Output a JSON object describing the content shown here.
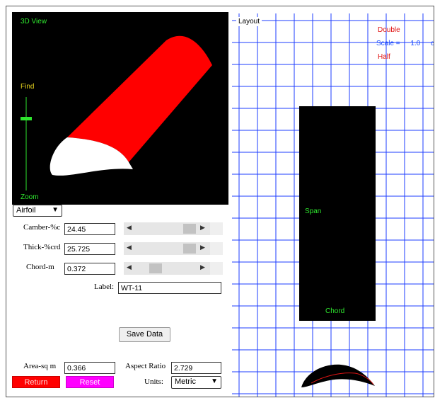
{
  "view3d": {
    "title": "3D View",
    "find_label": "Find",
    "zoom_label": "Zoom"
  },
  "shape_select": {
    "value": "Airfoil"
  },
  "params": [
    {
      "label": "Camber-%c",
      "value": "24.45",
      "slider_fraction": 0.72
    },
    {
      "label": "Thick-%crd",
      "value": "25.725",
      "slider_fraction": 0.75
    },
    {
      "label": "Chord-m",
      "value": "0.372",
      "slider_fraction": 0.36
    }
  ],
  "label_field": {
    "label": "Label:",
    "value": "WT-11"
  },
  "save_button": "Save Data",
  "area": {
    "label": "Area-sq m",
    "value": "0.366"
  },
  "aspect": {
    "label": "Aspect Ratio",
    "value": "2.729"
  },
  "return_button": "Return",
  "reset_button": "Reset",
  "units": {
    "label": "Units:",
    "value": "Metric"
  },
  "layout": {
    "title": "Layout",
    "double_label": "Double",
    "scale_label": "Scale =",
    "scale_value": "1.0",
    "scale_unit": "dr",
    "half_label": "Half",
    "span_label": "Span",
    "chord_label": "Chord"
  },
  "colors": {
    "wing": "#ff0000",
    "airfoil": "#ffffff",
    "grid": "#1e3cff",
    "accent_green": "#2ee62e"
  },
  "icons": {
    "dropdown": "chevron-down-icon",
    "slider_left": "triangle-left-icon",
    "slider_right": "triangle-right-icon"
  }
}
